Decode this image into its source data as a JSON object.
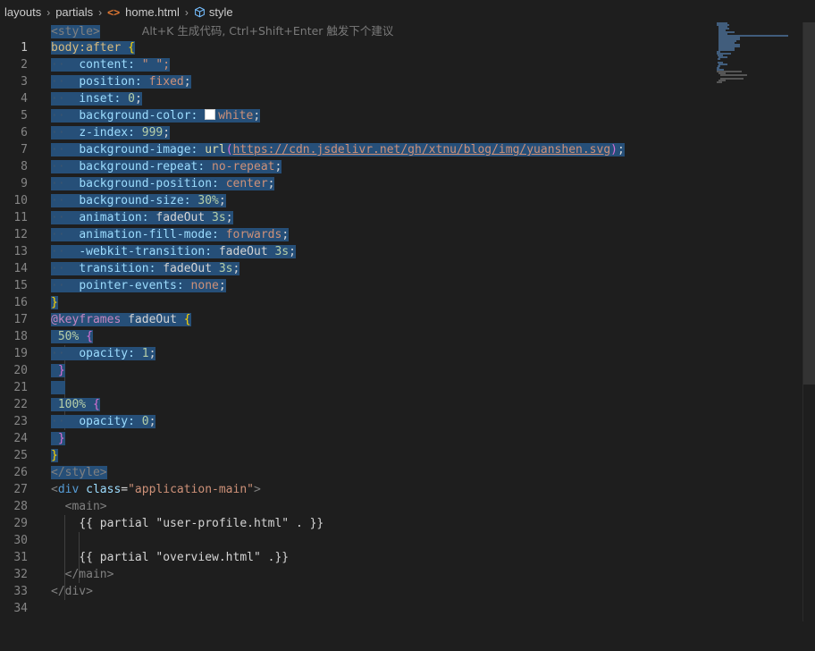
{
  "breadcrumb": {
    "items": [
      "layouts",
      "partials",
      "home.html",
      "style"
    ],
    "file_icon": "<>",
    "separator_icon": "chevron-right-icon",
    "symbol_icon": "cube-icon"
  },
  "editor": {
    "active_line": 1,
    "inline_hint": "Alt+K 生成代码, Ctrl+Shift+Enter 触发下个建议",
    "line_numbers": [
      "1",
      "2",
      "3",
      "4",
      "5",
      "6",
      "7",
      "8",
      "9",
      "10",
      "11",
      "12",
      "13",
      "14",
      "15",
      "16",
      "17",
      "18",
      "19",
      "20",
      "21",
      "22",
      "23",
      "24",
      "25",
      "26",
      "27",
      "28",
      "29",
      "30",
      "31",
      "32",
      "33",
      "34"
    ],
    "code": {
      "l1_tag": "<style>",
      "l2_sel": "body:after",
      "l2_br": "{",
      "l3_p": "content:",
      "l3_v": "\" \";",
      "l4_p": "position:",
      "l4_v": "fixed",
      "l5_p": "inset:",
      "l5_v": "0",
      "l6_p": "background-color:",
      "l6_v": "white",
      "l7_p": "z-index:",
      "l7_v": "999",
      "l8_p": "background-image:",
      "l8_fn": "url",
      "l8_url": "https://cdn.jsdelivr.net/gh/xtnu/blog/img/yuanshen.svg",
      "l9_p": "background-repeat:",
      "l9_v": "no-repeat",
      "l10_p": "background-position:",
      "l10_v": "center",
      "l11_p": "background-size:",
      "l11_v": "30%",
      "l12_p": "animation:",
      "l12_v1": "fadeOut",
      "l12_v2": "3s",
      "l13_p": "animation-fill-mode:",
      "l13_v": "forwards",
      "l14_p": "-webkit-transition:",
      "l14_v1": "fadeOut",
      "l14_v2": "3s",
      "l15_p": "transition:",
      "l15_v1": "fadeOut",
      "l15_v2": "3s",
      "l16_p": "pointer-events:",
      "l16_v": "none",
      "l17_br": "}",
      "l18_at": "@keyframes",
      "l18_name": "fadeOut",
      "l18_br": "{",
      "l19_pct": "50%",
      "l19_br": "{",
      "l20_p": "opacity:",
      "l20_v": "1",
      "l21_br": "}",
      "l23_pct": "100%",
      "l23_br": "{",
      "l24_p": "opacity:",
      "l24_v": "0",
      "l25_br": "}",
      "l26_br": "}",
      "l27_tag": "</style>",
      "l28_open": "<",
      "l28_tag": "div",
      "l28_attr": "class",
      "l28_eq": "=",
      "l28_val": "\"application-main\"",
      "l28_close": ">",
      "l29_tag": "<main>",
      "l30_text": "{{ partial ",
      "l30_str": "\"user-profile.html\"",
      "l30_end": " . }}",
      "l32_text": "{{ partial ",
      "l32_str": "\"overview.html\"",
      "l32_end": " .}}",
      "l33_tag": "</main>",
      "l34_tag": "</div>"
    }
  }
}
